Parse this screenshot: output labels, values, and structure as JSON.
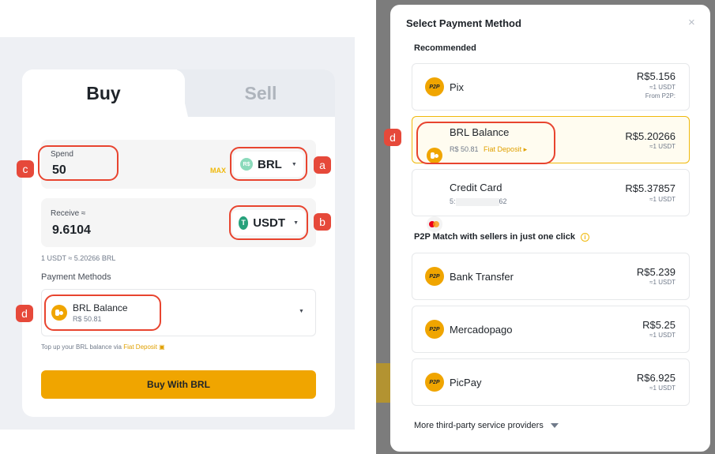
{
  "buy_panel": {
    "tab_buy": "Buy",
    "tab_sell": "Sell",
    "spend_label": "Spend",
    "spend_value": "50",
    "max_label": "MAX",
    "spend_currency": "BRL",
    "spend_currency_icon": "R$",
    "receive_label": "Receive ≈",
    "receive_value": "9.6104",
    "receive_currency": "USDT",
    "receive_currency_icon": "T",
    "rate_text": "1 USDT ≈ 5.20266 BRL",
    "payment_methods_label": "Payment Methods",
    "selected_method_name": "BRL Balance",
    "selected_method_balance": "R$ 50.81",
    "topup_text": "Top up your BRL balance via",
    "topup_link": "Fiat Deposit",
    "buy_button": "Buy With BRL",
    "markers": {
      "a": "a",
      "b": "b",
      "c": "c",
      "d": "d"
    }
  },
  "payment_modal": {
    "title": "Select Payment Method",
    "close_icon": "×",
    "recommended_label": "Recommended",
    "marker_d": "d",
    "recommended": [
      {
        "name": "Pix",
        "icon": "P2P",
        "price": "R$5.156",
        "per": "≈1 USDT",
        "note": "From P2P:"
      },
      {
        "name": "BRL Balance",
        "sub": "R$ 50.81",
        "link": "Fiat Deposit ▸",
        "price": "R$5.20266",
        "per": "≈1 USDT"
      },
      {
        "name": "Credit Card",
        "sub_prefix": "5:",
        "sub_suffix": "62",
        "price": "R$5.37857",
        "per": "≈1 USDT"
      }
    ],
    "p2p_label": "P2P Match with sellers in just one click",
    "p2p_info_icon": "i",
    "p2p": [
      {
        "name": "Bank Transfer",
        "icon": "P2P",
        "price": "R$5.239",
        "per": "≈1 USDT"
      },
      {
        "name": "Mercadopago",
        "icon": "P2P",
        "price": "R$5.25",
        "per": "≈1 USDT"
      },
      {
        "name": "PicPay",
        "icon": "P2P",
        "price": "R$6.925",
        "per": "≈1 USDT"
      }
    ],
    "more_providers": "More third-party service providers"
  },
  "colors": {
    "accent": "#f0a500",
    "marker_red": "#e6493a",
    "ring_red": "#e8442f",
    "usdt_green": "#26a17b"
  }
}
